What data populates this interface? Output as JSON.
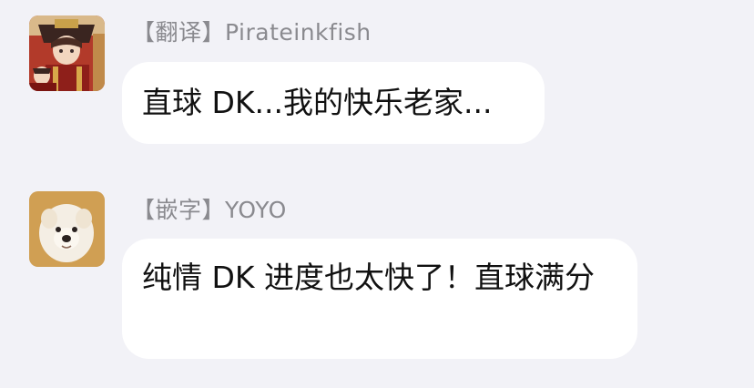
{
  "messages": [
    {
      "sender": "【翻译】Pirateinkfish",
      "avatar_icon": "anime-character-avatar",
      "text": "直球 DK...我的快乐老家..."
    },
    {
      "sender": "【嵌字】YOYO",
      "avatar_icon": "dog-avatar",
      "text": "纯情 DK 进度也太快了！直球满分"
    }
  ],
  "colors": {
    "background": "#f2f2f7",
    "bubble": "#ffffff",
    "sender_text": "#8a8a8f",
    "message_text": "#111111"
  }
}
